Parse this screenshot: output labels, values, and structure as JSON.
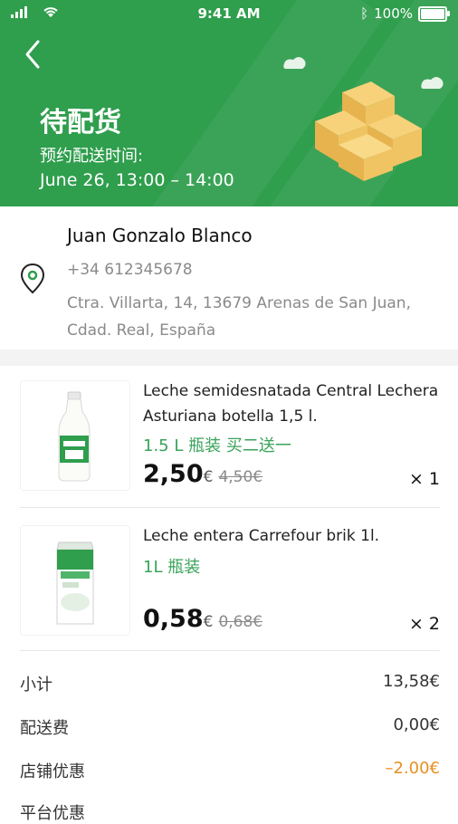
{
  "status_bar": {
    "time": "9:41 AM",
    "battery": "100%"
  },
  "header": {
    "title": "待配货",
    "subtitle": "预约配送时间:",
    "delivery_time": "June 26, 13:00 – 14:00",
    "bg_color": "#2f9e4d"
  },
  "address": {
    "name": "Juan Gonzalo Blanco",
    "phone": "+34 612345678",
    "line": "Ctra. Villarta, 14, 13679 Arenas de San Juan, Cdad. Real, España"
  },
  "products": [
    {
      "name": "Leche semidesnatada Central Lechera Asturiana botella 1,5 l.",
      "variant": "1.5 L 瓶装 买二送一",
      "price": "2,50",
      "currency": "€",
      "old_price": "4,50€",
      "qty": "× 1"
    },
    {
      "name": "Leche entera Carrefour brik 1l.",
      "variant": "1L 瓶装",
      "price": "0,58",
      "currency": "€",
      "old_price": "0,68€",
      "qty": "× 2"
    }
  ],
  "summary": {
    "subtotal_label": "小计",
    "subtotal_value": "13,58€",
    "delivery_label": "配送费",
    "delivery_value": "0,00€",
    "store_discount_label": "店铺优惠",
    "store_discount_value": "–2.00€",
    "platform_discount_label": "平台优惠"
  },
  "colors": {
    "accent_green": "#39a35a",
    "discount_orange": "#e89020"
  }
}
